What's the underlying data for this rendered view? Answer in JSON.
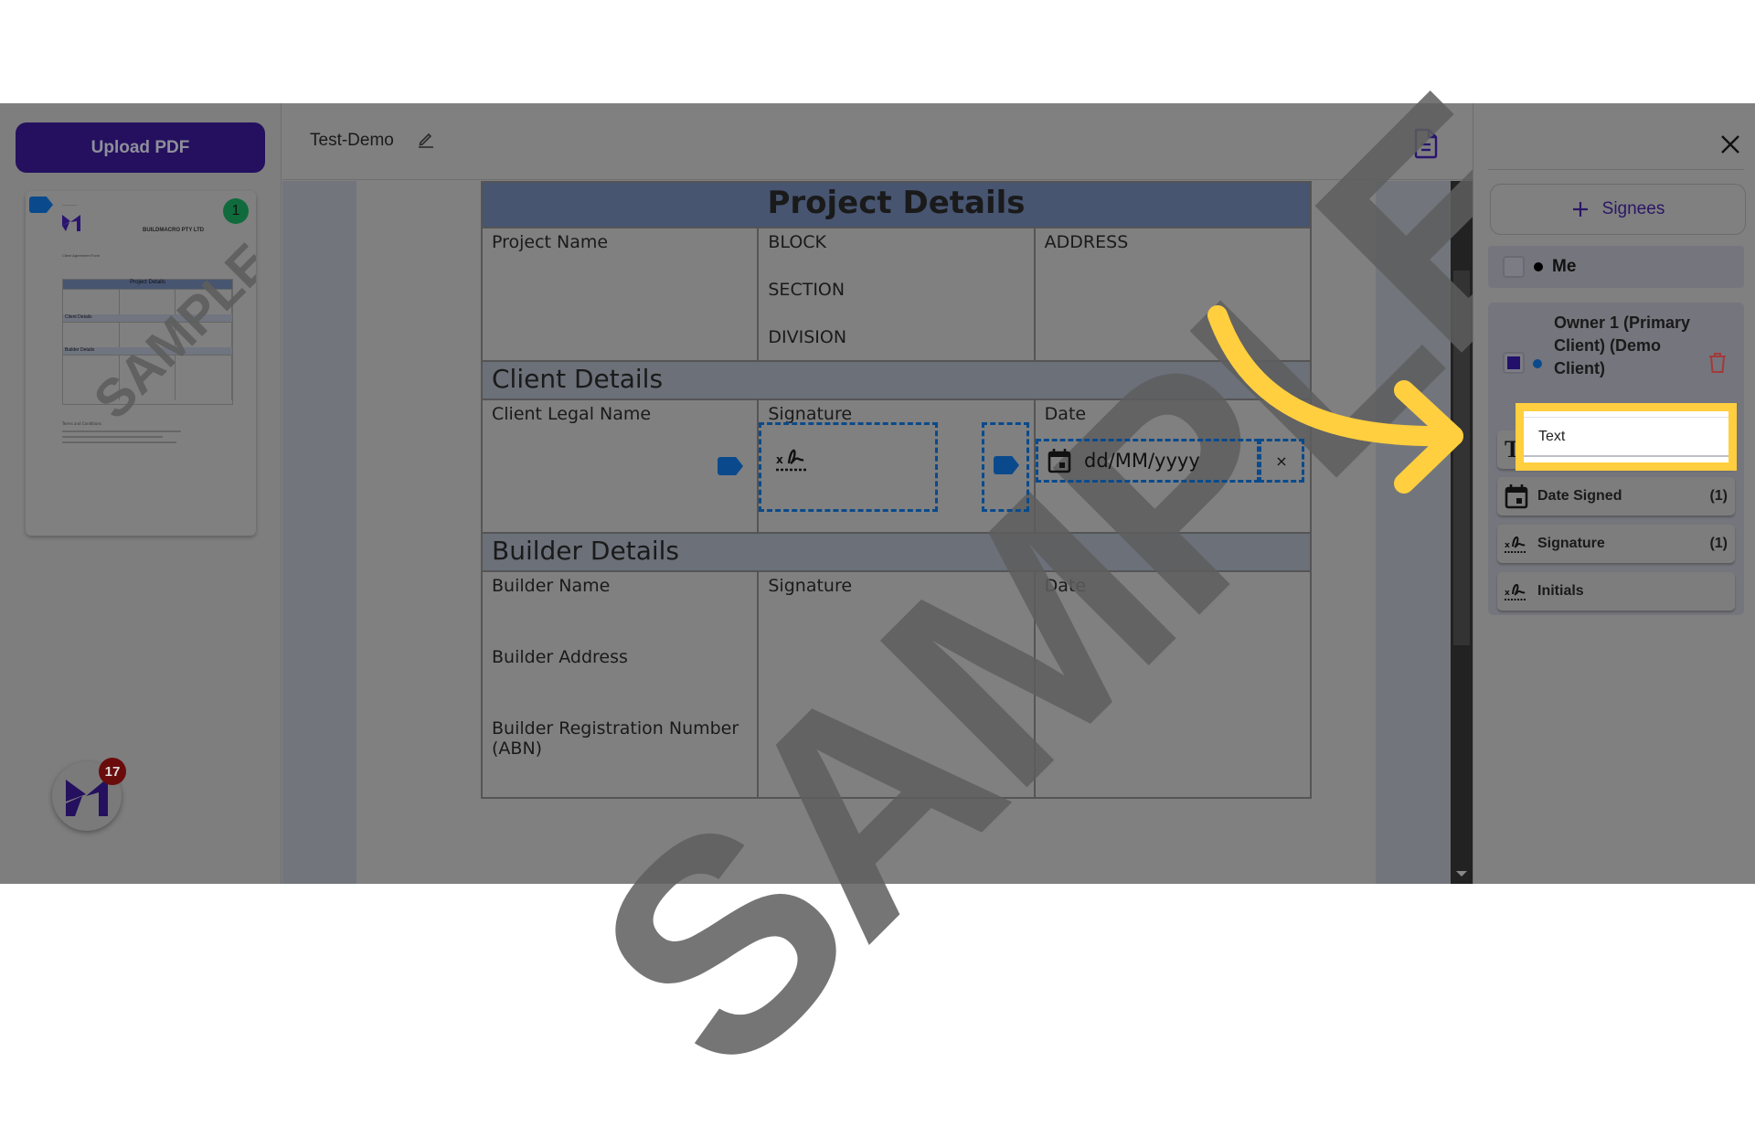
{
  "left_sidebar": {
    "upload_label": "Upload PDF",
    "thumbnail": {
      "page_number": "1",
      "company": "BUILDMACRO PTY LTD",
      "form_name": "Client Agreement Form",
      "table_title": "Project Details",
      "section_client": "Client Details",
      "section_builder": "Builder Details",
      "terms_title": "Terms and Conditions",
      "watermark": "SAMPLE"
    },
    "chat_badge_count": "17"
  },
  "topbar": {
    "document_title": "Test-Demo"
  },
  "document": {
    "title": "Project Details",
    "project_row": {
      "col1": "Project Name",
      "col2_lines": [
        "BLOCK",
        "SECTION",
        "DIVISION"
      ],
      "col3": "ADDRESS"
    },
    "client_section": {
      "title": "Client Details",
      "col1": "Client Legal Name",
      "col2": "Signature",
      "col3": "Date"
    },
    "builder_section": {
      "title": "Builder Details",
      "col1_lines": [
        "Builder Name",
        "Builder Address",
        "Builder Registration Number (ABN)"
      ],
      "col2": "Signature",
      "col3": "Date"
    },
    "watermark": "SAMPLE",
    "date_field_placeholder": "dd/MM/yyyy",
    "date_clear_label": "×"
  },
  "right_panel": {
    "add_signees_label": "Signees",
    "signees": [
      {
        "name": "Me",
        "dot_color": "#000000",
        "checked": false
      },
      {
        "name": "Owner 1 (Primary Client) (Demo Client)",
        "dot_color": "#0a4a8c",
        "checked": true
      }
    ],
    "fields": [
      {
        "label": "Text",
        "icon": "text-icon",
        "count": ""
      },
      {
        "label": "Date Signed",
        "icon": "calendar-icon",
        "count": "(1)"
      },
      {
        "label": "Signature",
        "icon": "signature-icon",
        "count": "(1)"
      },
      {
        "label": "Initials",
        "icon": "initials-icon",
        "count": ""
      }
    ],
    "highlighted_field": "Text"
  },
  "colors": {
    "brand_primary": "#24105e",
    "field_blue": "#0a4a8c",
    "highlight_yellow": "#ffcf3f",
    "delete_red": "#a33a3a"
  }
}
